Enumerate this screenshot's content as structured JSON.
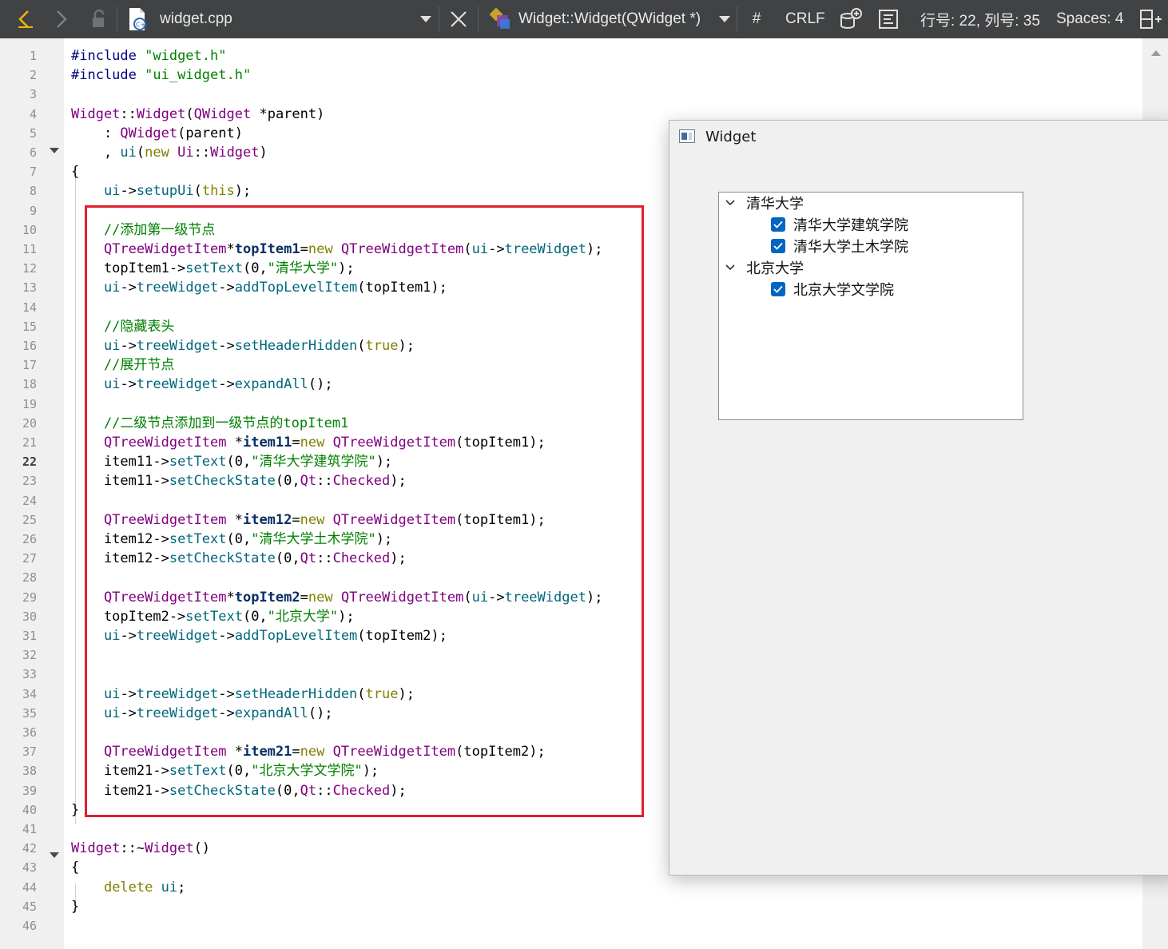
{
  "toolbar": {
    "filename": "widget.cpp",
    "symbol": "Widget::Widget(QWidget *)",
    "hash": "#",
    "line_ending": "CRLF",
    "position": "行号: 22, 列号: 35",
    "spaces": "Spaces: 4"
  },
  "editor": {
    "current_line": 22,
    "line_numbers": [
      "1",
      "2",
      "3",
      "4",
      "5",
      "6",
      "7",
      "8",
      "9",
      "10",
      "11",
      "12",
      "13",
      "14",
      "15",
      "16",
      "17",
      "18",
      "19",
      "20",
      "21",
      "22",
      "23",
      "24",
      "25",
      "26",
      "27",
      "28",
      "29",
      "30",
      "31",
      "32",
      "33",
      "34",
      "35",
      "36",
      "37",
      "38",
      "39",
      "40",
      "41",
      "42",
      "43",
      "44",
      "45",
      "46"
    ],
    "code": [
      "#include \"widget.h\"",
      "#include \"ui_widget.h\"",
      "",
      "Widget::Widget(QWidget *parent)",
      "    : QWidget(parent)",
      "    , ui(new Ui::Widget)",
      "{",
      "    ui->setupUi(this);",
      "",
      "    //添加第一级节点",
      "    QTreeWidgetItem*topItem1=new QTreeWidgetItem(ui->treeWidget);",
      "    topItem1->setText(0,\"清华大学\");",
      "    ui->treeWidget->addTopLevelItem(topItem1);",
      "",
      "    //隐藏表头",
      "    ui->treeWidget->setHeaderHidden(true);",
      "    //展开节点",
      "    ui->treeWidget->expandAll();",
      "",
      "    //二级节点添加到一级节点的topItem1",
      "    QTreeWidgetItem *item11=new QTreeWidgetItem(topItem1);",
      "    item11->setText(0,\"清华大学建筑学院\");",
      "    item11->setCheckState(0,Qt::Checked);",
      "",
      "    QTreeWidgetItem *item12=new QTreeWidgetItem(topItem1);",
      "    item12->setText(0,\"清华大学土木学院\");",
      "    item12->setCheckState(0,Qt::Checked);",
      "",
      "    QTreeWidgetItem*topItem2=new QTreeWidgetItem(ui->treeWidget);",
      "    topItem2->setText(0,\"北京大学\");",
      "    ui->treeWidget->addTopLevelItem(topItem2);",
      "",
      "",
      "    ui->treeWidget->setHeaderHidden(true);",
      "    ui->treeWidget->expandAll();",
      "",
      "    QTreeWidgetItem *item21=new QTreeWidgetItem(topItem2);",
      "    item21->setText(0,\"北京大学文学院\");",
      "    item21->setCheckState(0,Qt::Checked);",
      "}",
      "",
      "Widget::~Widget()",
      "{",
      "    delete ui;",
      "}",
      ""
    ]
  },
  "window": {
    "title": "Widget",
    "tree": [
      {
        "label": "清华大学",
        "expanded": true,
        "children": [
          {
            "label": "清华大学建筑学院",
            "checked": true
          },
          {
            "label": "清华大学土木学院",
            "checked": true
          }
        ]
      },
      {
        "label": "北京大学",
        "expanded": true,
        "children": [
          {
            "label": "北京大学文学院",
            "checked": true
          }
        ]
      }
    ]
  }
}
